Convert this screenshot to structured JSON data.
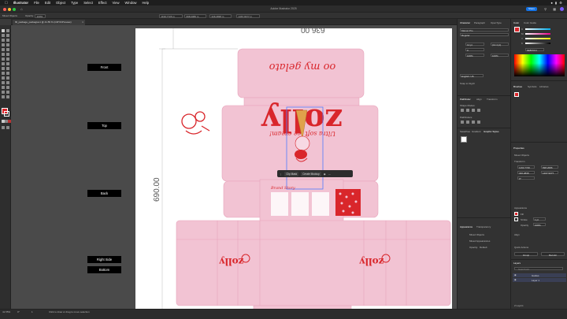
{
  "menubar": {
    "app": "Illustrator",
    "items": [
      "File",
      "Edit",
      "Object",
      "Type",
      "Select",
      "Effect",
      "View",
      "Window",
      "Help"
    ],
    "clock": ""
  },
  "window": {
    "title": "Adobe Illustrator 2025",
    "share": "Share"
  },
  "control_bar": {
    "mixed_objects": "Mixed Objects",
    "opacity_label": "Opacity:",
    "opacity_value": "100%",
    "x_value": "1193.7726 m",
    "y_value": "698.2086 m",
    "w_value": "346.2838 m",
    "h_value": "1467.9377 m"
  },
  "document_tab": "fifi_package_packagive1 @ 41.55 % (CMYK/Preview)",
  "artboard_labels": [
    "Front",
    "Top",
    "Back",
    "Right Side",
    "Bottom"
  ],
  "dimension_labels": [
    "690.00",
    "636.00"
  ],
  "artwork": {
    "brand": "zolly",
    "tagline_top": "oo my gelato",
    "tagline_mid": "Ultra soft ice cream!",
    "story_title": "Brand Story"
  },
  "context_bar": {
    "clip_mask": "Clip Mask",
    "create_mockup": "Create Mockup"
  },
  "character_panel": {
    "tabs": [
      "Character",
      "Paragraph",
      "OpenType"
    ],
    "font": "Marvel Pro",
    "style": "Regular",
    "size": "12 pt",
    "leading": "(14.4 pt)",
    "tracking": "0",
    "scale_v": "100%",
    "scale_h": "100%",
    "language": "English: US",
    "snap": "Snap to Glyph"
  },
  "pathfinder_panel": {
    "tabs": [
      "Pathfinder",
      "Align",
      "Transform"
    ],
    "shape_modes": "Shape Modes:",
    "pathfinders": "Pathfinders:"
  },
  "swatches_panel": {
    "tabs": [
      "Swatches",
      "Gradient",
      "Graphic Styles"
    ]
  },
  "appearance_panel": {
    "tabs": [
      "Appearance",
      "Transparency"
    ],
    "mixed_objects": "Mixed Objects",
    "mixed_appearances": "Mixed Appearances",
    "opacity_label": "Opacity:",
    "opacity_value": "Default"
  },
  "color_panel": {
    "tabs": [
      "Color",
      "Color Guide"
    ],
    "c_label": "C",
    "m_label": "M",
    "y_label": "Y",
    "k_label": "K",
    "hex": "#E8F6C4"
  },
  "brushes_panel": {
    "tabs": [
      "Brushes",
      "Symbols",
      "Libraries"
    ]
  },
  "properties_panel": {
    "title": "Properties",
    "mixed_objects": "Mixed Objects",
    "transform_label": "Transform",
    "x": "1193.7726",
    "y": "698.2086",
    "w": "346.2838",
    "h": "1467.9377",
    "angle": "0°",
    "appearance_label": "Appearance",
    "fill_label": "Fill",
    "stroke_label": "Stroke",
    "stroke_value": "1 pt",
    "opacity_label": "Opacity",
    "opacity_value": "100%",
    "align_label": "Align",
    "quick_actions_label": "Quick Actions",
    "group_button": "Group",
    "recolor_button": "Recolor"
  },
  "layers_panel": {
    "title": "Layers",
    "search_placeholder": "Search All",
    "layers": [
      "Guides",
      "Layer 1"
    ],
    "count": "2 Layers"
  },
  "status_bar": {
    "zoom": "41.55%",
    "angle": "0°",
    "message": "Click to draw or drag to move selection",
    "artboard_number": "1"
  },
  "colors": {
    "accent": "#1473e6",
    "pink": "#f2c3d3",
    "red": "#d9262b",
    "selection": "#4f7cff"
  }
}
